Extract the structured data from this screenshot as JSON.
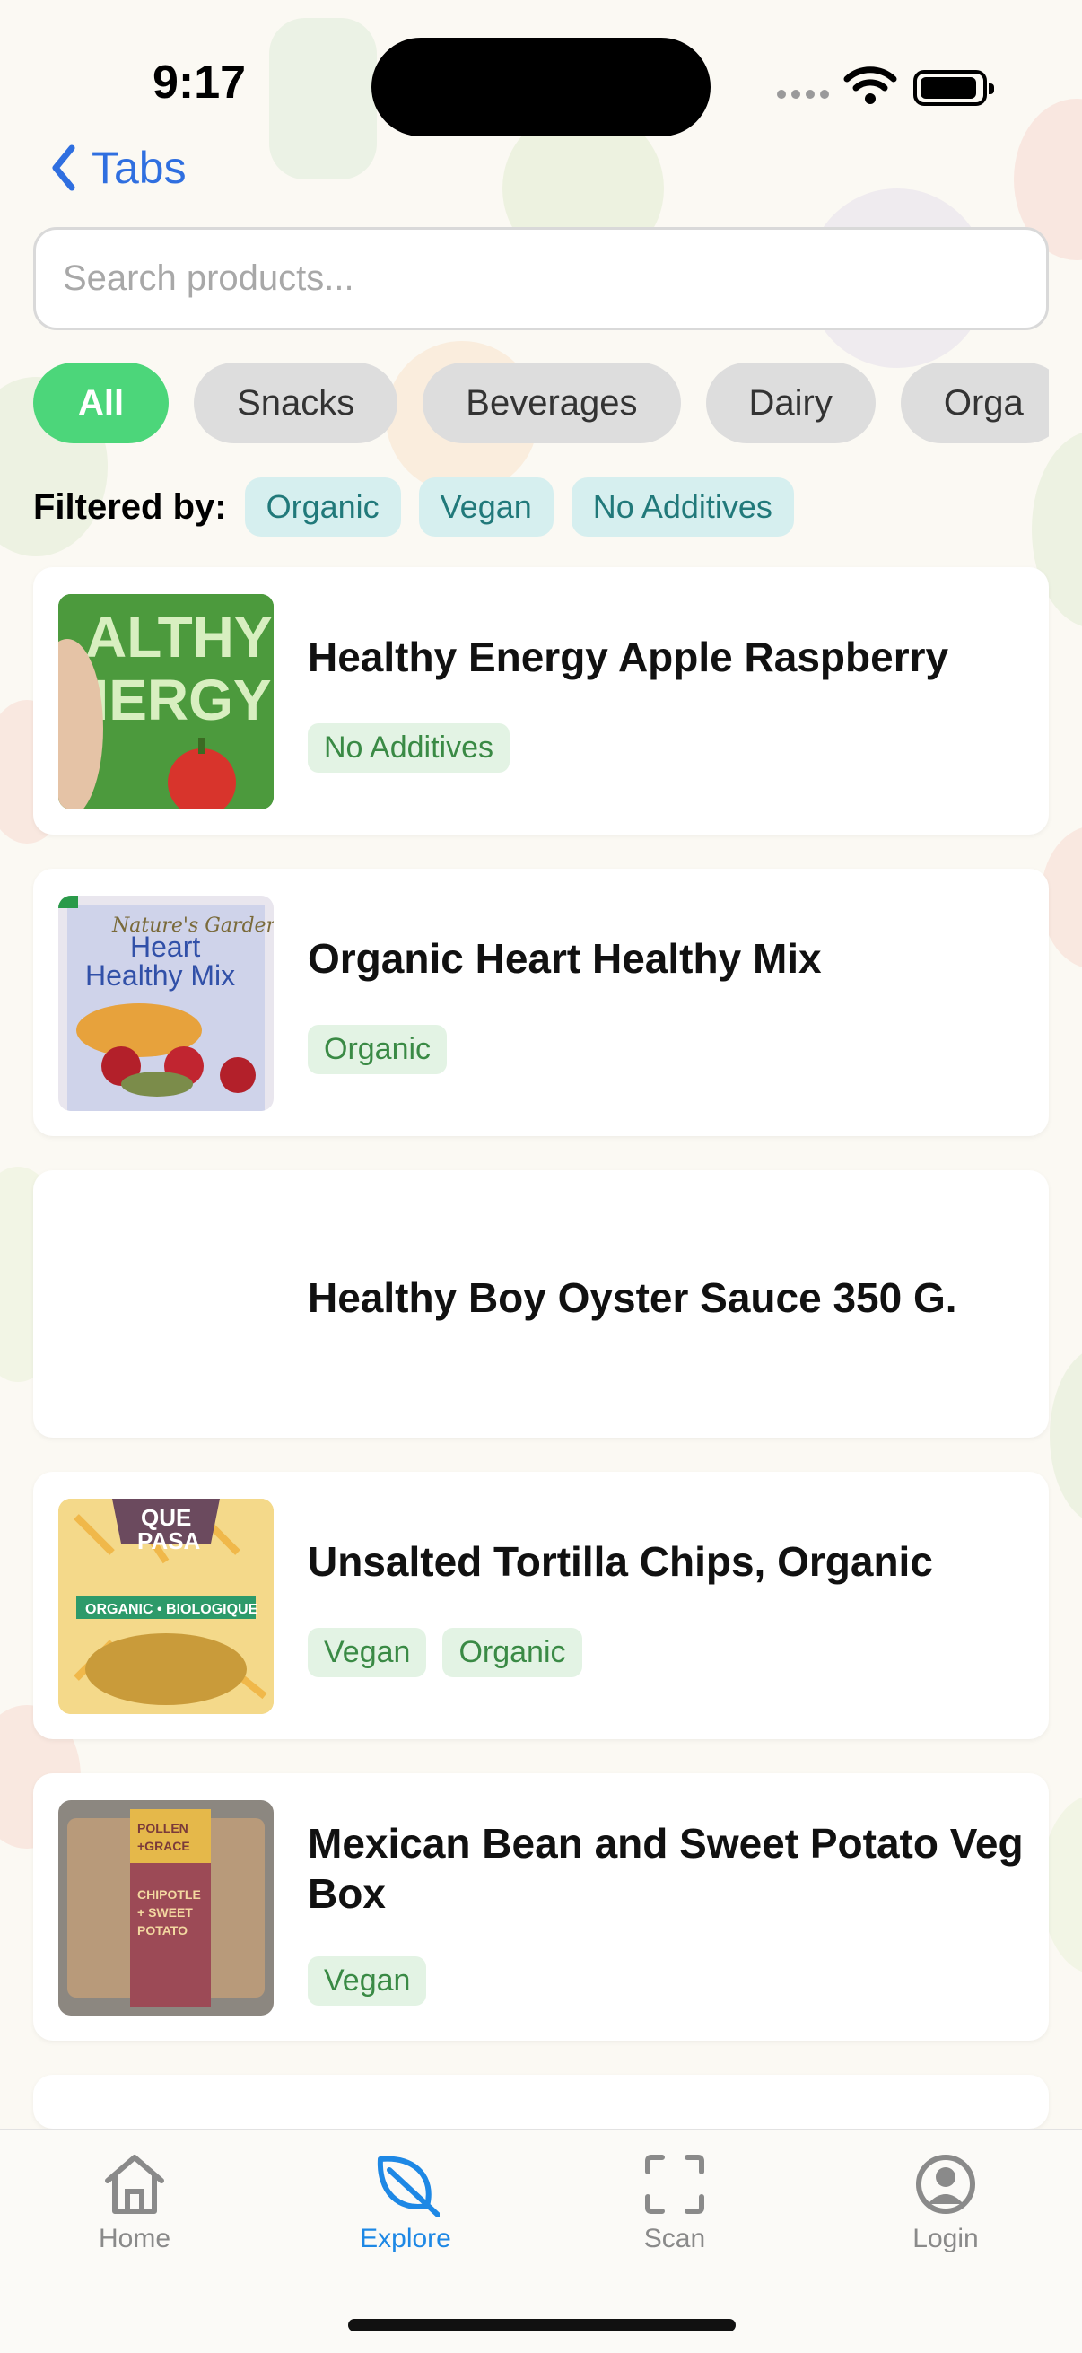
{
  "status": {
    "time": "9:17"
  },
  "nav": {
    "back_label": "Tabs"
  },
  "search": {
    "placeholder": "Search products..."
  },
  "categories": [
    {
      "label": "All",
      "active": true
    },
    {
      "label": "Snacks",
      "active": false
    },
    {
      "label": "Beverages",
      "active": false
    },
    {
      "label": "Dairy",
      "active": false
    },
    {
      "label": "Orga",
      "active": false
    }
  ],
  "filters": {
    "label": "Filtered by:",
    "tags": [
      "Organic",
      "Vegan",
      "No Additives"
    ]
  },
  "products": [
    {
      "name": "Healthy Energy Apple Raspberry",
      "tags": [
        "No Additives"
      ],
      "image": "can-photo"
    },
    {
      "name": "Organic Heart Healthy Mix",
      "tags": [
        "Organic"
      ],
      "image": "bag-photo"
    },
    {
      "name": "Healthy Boy Oyster Sauce 350 G.",
      "tags": [],
      "image": ""
    },
    {
      "name": "Unsalted Tortilla Chips, Organic",
      "tags": [
        "Vegan",
        "Organic"
      ],
      "image": "chips-photo"
    },
    {
      "name": "Mexican Bean and Sweet Potato Veg Box",
      "tags": [
        "Vegan"
      ],
      "image": "box-photo"
    }
  ],
  "tabbar": {
    "items": [
      {
        "label": "Home",
        "icon": "house-icon",
        "active": false
      },
      {
        "label": "Explore",
        "icon": "leaf-icon",
        "active": true
      },
      {
        "label": "Scan",
        "icon": "scan-icon",
        "active": false
      },
      {
        "label": "Login",
        "icon": "person-icon",
        "active": false
      }
    ]
  },
  "colors": {
    "accent_green": "#4cd67a",
    "link_blue": "#2f6fe0",
    "tab_active": "#1e88e5",
    "filter_tag_bg": "#d6efef",
    "product_tag_bg": "#e3f3e4"
  }
}
